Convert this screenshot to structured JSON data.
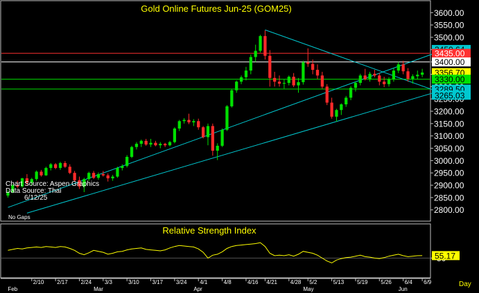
{
  "colors": {
    "background": "#000000",
    "frame": "#c0c0c0",
    "up_candle": "#00e000",
    "down_candle": "#ff2a2a",
    "trendline": "#00c8d0",
    "resistance": "#ff3030",
    "support": "#00e000",
    "pivot": "#ffffff",
    "rsi": "#ffff00",
    "text": "#ffffff",
    "title": "#ffff00"
  },
  "chart_data": [
    {
      "type": "candlestick",
      "title": "Gold Online Futures Jun-25 (GOM25)",
      "notes": [
        "Chart Source: Aspen Graphics",
        "Data Source: Thai",
        "6/12/25"
      ],
      "footer_note": "No Gaps",
      "ylim": [
        2760,
        3640
      ],
      "y_ticks": [
        2800,
        2850,
        2900,
        2950,
        3000,
        3050,
        3100,
        3150,
        3200,
        3250,
        3300,
        3350,
        3400,
        3450,
        3500,
        3550,
        3600
      ],
      "y_tick_labels": [
        "2800.00",
        "2850.00",
        "2900.00",
        "2950.00",
        "3000.00",
        "3050.00",
        "3100.00",
        "3150.00",
        "3200.00",
        "3250.00",
        "3300.00",
        "3350.00",
        "3400.00",
        "3450.00",
        "3500.00",
        "3550.00",
        "3600.00"
      ],
      "price_labels": [
        {
          "value": 3450.64,
          "text": "3450.64",
          "color": "#00c8d0",
          "line": false
        },
        {
          "value": 3435.0,
          "text": "3435.00",
          "color": "#ff3030",
          "line": true
        },
        {
          "value": 3400.0,
          "text": "3400.00",
          "color": "#ffffff",
          "line": true
        },
        {
          "value": 3356.7,
          "text": "3356.70",
          "color": "#ffff00",
          "line": false
        },
        {
          "value": 3330.0,
          "text": "3330.00",
          "color": "#00e000",
          "line": true
        },
        {
          "value": 3290.0,
          "text": "3290.00",
          "color": "#00e000",
          "line": true
        },
        {
          "value": 3289.5,
          "text": "3289.50",
          "color": "#00c8d0",
          "line": false
        },
        {
          "value": 3265.03,
          "text": "3265.03",
          "color": "#00c8d0",
          "line": false
        }
      ],
      "x_ticks": [
        {
          "i": 5,
          "label": "2/10"
        },
        {
          "i": 10,
          "label": "2/17"
        },
        {
          "i": 15,
          "label": "2/24"
        },
        {
          "i": 20,
          "label": "3/3"
        },
        {
          "i": 25,
          "label": "3/10"
        },
        {
          "i": 30,
          "label": "3/17"
        },
        {
          "i": 35,
          "label": "3/24"
        },
        {
          "i": 40,
          "label": "4/1"
        },
        {
          "i": 45,
          "label": "4/8"
        },
        {
          "i": 50,
          "label": "4/16"
        },
        {
          "i": 54,
          "label": "4/21"
        },
        {
          "i": 59,
          "label": "4/28"
        },
        {
          "i": 63,
          "label": "5/2"
        },
        {
          "i": 68,
          "label": "5/13"
        },
        {
          "i": 73,
          "label": "5/19"
        },
        {
          "i": 78,
          "label": "5/26"
        },
        {
          "i": 83,
          "label": "6/4"
        },
        {
          "i": 87,
          "label": "6/9"
        }
      ],
      "month_labels": [
        {
          "i": 0,
          "label": "Feb"
        },
        {
          "i": 18,
          "label": "Mar"
        },
        {
          "i": 39,
          "label": "Apr"
        },
        {
          "i": 62,
          "label": "May"
        },
        {
          "i": 82,
          "label": "Jun"
        }
      ],
      "right_axis_label": "Day",
      "trendlines": [
        {
          "i1": 0,
          "v1": 2810,
          "i2": 92,
          "v2": 3452
        },
        {
          "i1": 4,
          "v1": 2787,
          "i2": 92,
          "v2": 3290
        },
        {
          "i1": 54,
          "v1": 3530,
          "i2": 92,
          "v2": 3268
        }
      ],
      "candles": [
        [
          2858,
          2880,
          2850,
          2872
        ],
        [
          2872,
          2905,
          2868,
          2900
        ],
        [
          2900,
          2918,
          2888,
          2895
        ],
        [
          2895,
          2930,
          2890,
          2928
        ],
        [
          2928,
          2945,
          2900,
          2910
        ],
        [
          2910,
          2930,
          2898,
          2925
        ],
        [
          2925,
          2960,
          2918,
          2955
        ],
        [
          2955,
          2962,
          2935,
          2940
        ],
        [
          2940,
          2975,
          2938,
          2970
        ],
        [
          2970,
          2990,
          2960,
          2985
        ],
        [
          2985,
          2990,
          2965,
          2970
        ],
        [
          2970,
          2995,
          2962,
          2990
        ],
        [
          2990,
          2998,
          2970,
          2975
        ],
        [
          2975,
          2985,
          2945,
          2950
        ],
        [
          2950,
          2958,
          2915,
          2920
        ],
        [
          2920,
          2935,
          2885,
          2895
        ],
        [
          2895,
          2930,
          2872,
          2925
        ],
        [
          2925,
          2955,
          2918,
          2950
        ],
        [
          2950,
          2958,
          2925,
          2930
        ],
        [
          2930,
          2952,
          2922,
          2945
        ],
        [
          2945,
          2958,
          2935,
          2940
        ],
        [
          2940,
          2948,
          2915,
          2928
        ],
        [
          2928,
          2942,
          2918,
          2935
        ],
        [
          2935,
          2975,
          2930,
          2970
        ],
        [
          2970,
          2985,
          2960,
          2978
        ],
        [
          2978,
          3022,
          2972,
          3015
        ],
        [
          3015,
          3060,
          3010,
          3055
        ],
        [
          3055,
          3075,
          3045,
          3068
        ],
        [
          3068,
          3085,
          3055,
          3080
        ],
        [
          3080,
          3088,
          3060,
          3065
        ],
        [
          3065,
          3088,
          3055,
          3072
        ],
        [
          3072,
          3080,
          3058,
          3062
        ],
        [
          3062,
          3075,
          3050,
          3068
        ],
        [
          3068,
          3072,
          3055,
          3062
        ],
        [
          3062,
          3080,
          3058,
          3075
        ],
        [
          3075,
          3135,
          3070,
          3130
        ],
        [
          3130,
          3165,
          3120,
          3160
        ],
        [
          3160,
          3172,
          3150,
          3165
        ],
        [
          3165,
          3190,
          3148,
          3155
        ],
        [
          3155,
          3168,
          3140,
          3160
        ],
        [
          3160,
          3170,
          3125,
          3135
        ],
        [
          3135,
          3140,
          3090,
          3095
        ],
        [
          3095,
          3150,
          3062,
          3140
        ],
        [
          3140,
          3150,
          3020,
          3040
        ],
        [
          3040,
          3070,
          3002,
          3060
        ],
        [
          3060,
          3130,
          3055,
          3125
        ],
        [
          3125,
          3225,
          3120,
          3220
        ],
        [
          3220,
          3290,
          3215,
          3285
        ],
        [
          3285,
          3325,
          3275,
          3320
        ],
        [
          3320,
          3345,
          3310,
          3338
        ],
        [
          3338,
          3380,
          3325,
          3365
        ],
        [
          3365,
          3430,
          3350,
          3420
        ],
        [
          3420,
          3470,
          3400,
          3445
        ],
        [
          3445,
          3510,
          3438,
          3505
        ],
        [
          3505,
          3528,
          3410,
          3425
        ],
        [
          3425,
          3448,
          3300,
          3335
        ],
        [
          3335,
          3360,
          3300,
          3320
        ],
        [
          3320,
          3345,
          3300,
          3312
        ],
        [
          3312,
          3330,
          3292,
          3315
        ],
        [
          3315,
          3345,
          3305,
          3340
        ],
        [
          3340,
          3355,
          3298,
          3305
        ],
        [
          3305,
          3335,
          3275,
          3318
        ],
        [
          3318,
          3405,
          3308,
          3398
        ],
        [
          3398,
          3455,
          3380,
          3392
        ],
        [
          3392,
          3410,
          3350,
          3368
        ],
        [
          3368,
          3390,
          3330,
          3345
        ],
        [
          3345,
          3360,
          3292,
          3300
        ],
        [
          3300,
          3310,
          3225,
          3235
        ],
        [
          3235,
          3255,
          3170,
          3178
        ],
        [
          3178,
          3210,
          3158,
          3205
        ],
        [
          3205,
          3232,
          3185,
          3228
        ],
        [
          3228,
          3262,
          3218,
          3255
        ],
        [
          3255,
          3302,
          3245,
          3295
        ],
        [
          3295,
          3320,
          3280,
          3315
        ],
        [
          3315,
          3352,
          3305,
          3345
        ],
        [
          3345,
          3372,
          3325,
          3330
        ],
        [
          3330,
          3360,
          3320,
          3352
        ],
        [
          3352,
          3368,
          3338,
          3345
        ],
        [
          3345,
          3355,
          3305,
          3320
        ],
        [
          3320,
          3340,
          3298,
          3310
        ],
        [
          3310,
          3338,
          3300,
          3330
        ],
        [
          3330,
          3375,
          3320,
          3365
        ],
        [
          3365,
          3400,
          3355,
          3390
        ],
        [
          3390,
          3405,
          3350,
          3362
        ],
        [
          3362,
          3375,
          3320,
          3332
        ],
        [
          3332,
          3350,
          3312,
          3342
        ],
        [
          3342,
          3365,
          3330,
          3348
        ],
        [
          3348,
          3372,
          3338,
          3357
        ]
      ]
    },
    {
      "type": "line",
      "title": "Relative Strength Index",
      "ylim": [
        15,
        95
      ],
      "y_ticks": [
        50
      ],
      "y_tick_labels": [
        "50"
      ],
      "last_value_label": "55.17",
      "values": [
        66,
        68,
        70,
        69,
        71,
        72,
        73,
        72,
        74,
        73,
        72,
        74,
        73,
        70,
        66,
        60,
        57,
        61,
        66,
        64,
        62,
        58,
        60,
        63,
        64,
        67,
        69,
        70,
        71,
        68,
        67,
        66,
        65,
        67,
        71,
        74,
        76,
        75,
        74,
        73,
        69,
        62,
        50,
        56,
        58,
        63,
        70,
        74,
        76,
        77,
        78,
        79,
        80,
        82,
        74,
        60,
        55,
        56,
        55,
        57,
        54,
        58,
        64,
        62,
        60,
        56,
        50,
        44,
        40,
        46,
        49,
        51,
        52,
        54,
        56,
        53,
        52,
        50,
        49,
        51,
        54,
        56,
        58,
        55,
        53,
        54,
        55,
        55.17
      ]
    }
  ]
}
